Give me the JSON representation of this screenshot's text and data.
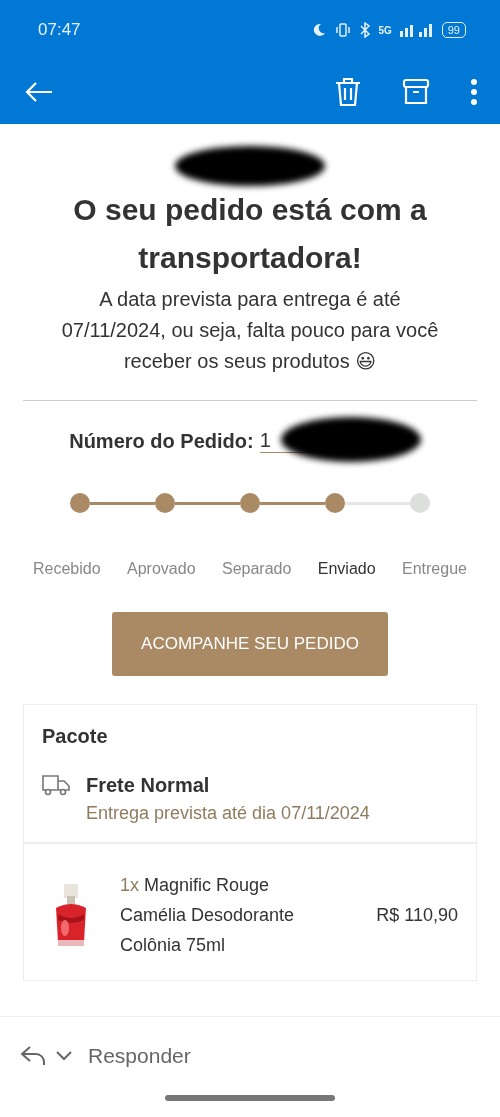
{
  "status_bar": {
    "time": "07:47",
    "network": "5G",
    "battery": "99"
  },
  "headline": "O seu pedido está com a transportadora!",
  "message": "A data prevista para entrega é até 07/11/2024, ou seja, falta pouco para você receber os seus produtos 😃",
  "order": {
    "label": "Número do Pedido:",
    "number": "1"
  },
  "steps": [
    {
      "label": "Recebido",
      "done": true,
      "selected": false
    },
    {
      "label": "Aprovado",
      "done": true,
      "selected": false
    },
    {
      "label": "Separado",
      "done": true,
      "selected": false
    },
    {
      "label": "Enviado",
      "done": true,
      "selected": true
    },
    {
      "label": "Entregue",
      "done": false,
      "selected": false
    }
  ],
  "track_button": "ACOMPANHE SEU PEDIDO",
  "package": {
    "title": "Pacote",
    "shipping": "Frete Normal",
    "eta": "Entrega prevista até dia 07/11/2024"
  },
  "items": [
    {
      "quantity": "1x",
      "name": "Magnific Rouge Camélia Desodorante Colônia 75ml",
      "price": "R$ 110,90",
      "kind": "picture"
    }
  ],
  "reply": {
    "label": "Responder"
  }
}
